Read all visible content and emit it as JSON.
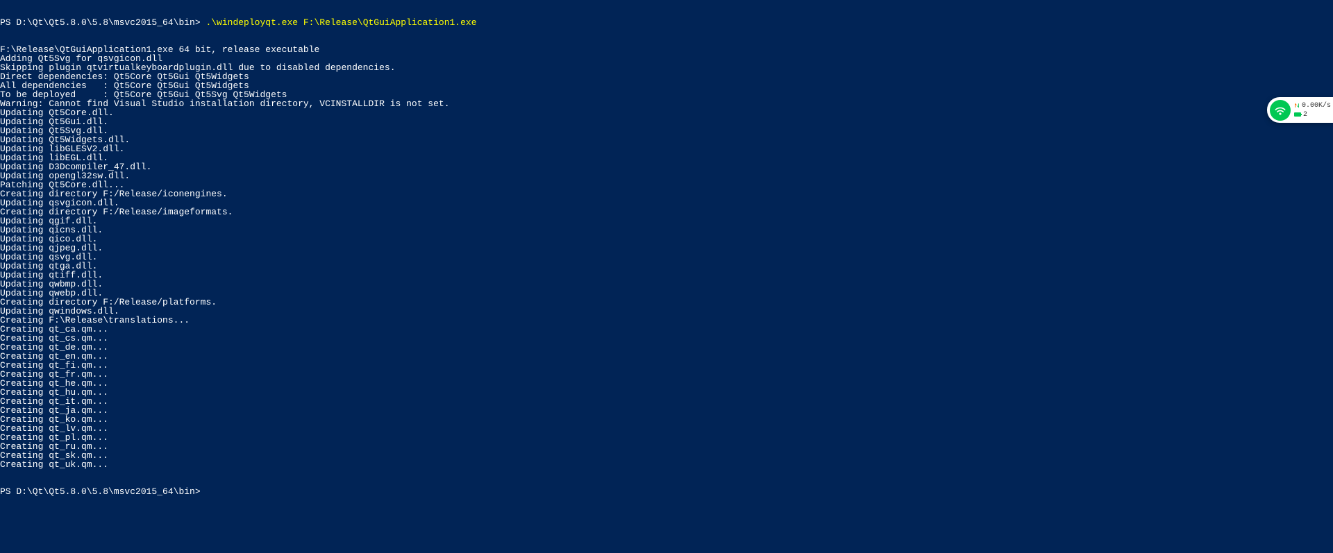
{
  "prompt1": {
    "ps": "PS D:\\Qt\\Qt5.8.0\\5.8\\msvc2015_64\\bin> ",
    "cmd": ".\\windeployqt.exe F:\\Release\\QtGuiApplication1.exe"
  },
  "lines": [
    "F:\\Release\\QtGuiApplication1.exe 64 bit, release executable",
    "Adding Qt5Svg for qsvgicon.dll",
    "Skipping plugin qtvirtualkeyboardplugin.dll due to disabled dependencies.",
    "Direct dependencies: Qt5Core Qt5Gui Qt5Widgets",
    "All dependencies   : Qt5Core Qt5Gui Qt5Widgets",
    "To be deployed     : Qt5Core Qt5Gui Qt5Svg Qt5Widgets",
    "Warning: Cannot find Visual Studio installation directory, VCINSTALLDIR is not set.",
    "Updating Qt5Core.dll.",
    "Updating Qt5Gui.dll.",
    "Updating Qt5Svg.dll.",
    "Updating Qt5Widgets.dll.",
    "Updating libGLESV2.dll.",
    "Updating libEGL.dll.",
    "Updating D3Dcompiler_47.dll.",
    "Updating opengl32sw.dll.",
    "Patching Qt5Core.dll...",
    "Creating directory F:/Release/iconengines.",
    "Updating qsvgicon.dll.",
    "Creating directory F:/Release/imageformats.",
    "Updating qgif.dll.",
    "Updating qicns.dll.",
    "Updating qico.dll.",
    "Updating qjpeg.dll.",
    "Updating qsvg.dll.",
    "Updating qtga.dll.",
    "Updating qtiff.dll.",
    "Updating qwbmp.dll.",
    "Updating qwebp.dll.",
    "Creating directory F:/Release/platforms.",
    "Updating qwindows.dll.",
    "Creating F:\\Release\\translations...",
    "Creating qt_ca.qm...",
    "Creating qt_cs.qm...",
    "Creating qt_de.qm...",
    "Creating qt_en.qm...",
    "Creating qt_fi.qm...",
    "Creating qt_fr.qm...",
    "Creating qt_he.qm...",
    "Creating qt_hu.qm...",
    "Creating qt_it.qm...",
    "Creating qt_ja.qm...",
    "Creating qt_ko.qm...",
    "Creating qt_lv.qm...",
    "Creating qt_pl.qm...",
    "Creating qt_ru.qm...",
    "Creating qt_sk.qm...",
    "Creating qt_uk.qm..."
  ],
  "prompt2": "PS D:\\Qt\\Qt5.8.0\\5.8\\msvc2015_64\\bin>",
  "widget": {
    "speed": "0.00K/s",
    "battery": "2"
  }
}
